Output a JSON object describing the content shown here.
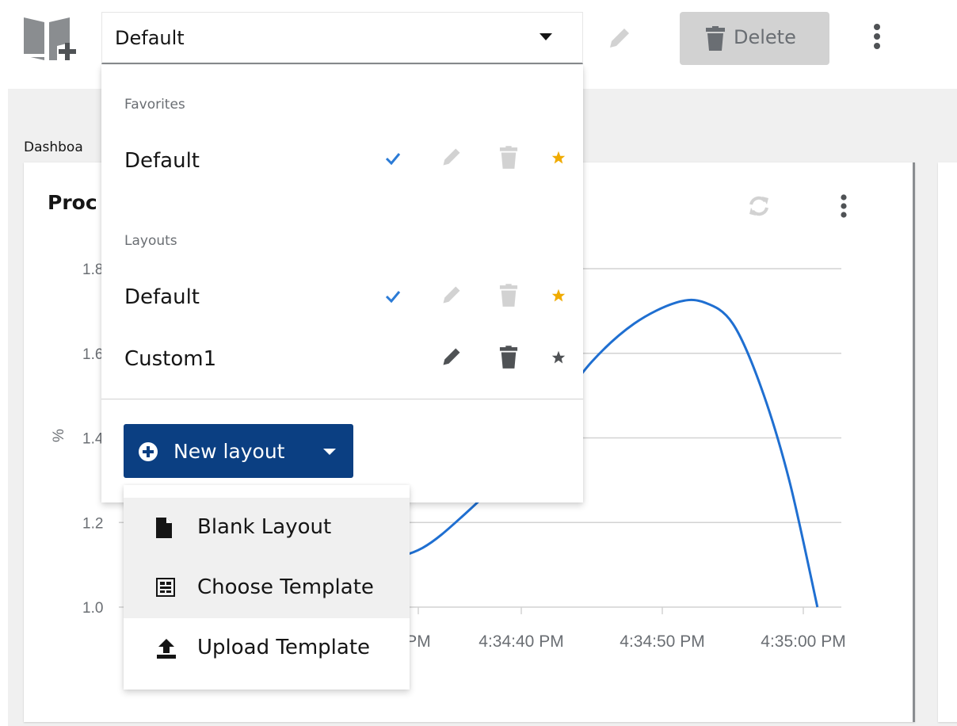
{
  "toolbar": {
    "selected_layout": "Default",
    "delete_label": "Delete"
  },
  "dashboard": {
    "title": "Dashboa",
    "card_title": "Proc"
  },
  "layout_menu": {
    "favorites_title": "Favorites",
    "favorites": [
      {
        "label": "Default",
        "selected": true,
        "favorite": true
      }
    ],
    "layouts_title": "Layouts",
    "layouts": [
      {
        "label": "Default",
        "selected": true,
        "favorite": true
      },
      {
        "label": "Custom1",
        "selected": false,
        "favorite": false
      }
    ],
    "new_layout_label": "New layout",
    "new_layout_options": [
      {
        "label": "Blank Layout",
        "icon": "file-icon"
      },
      {
        "label": "Choose Template",
        "icon": "template-icon"
      },
      {
        "label": "Upload Template",
        "icon": "upload-icon"
      }
    ]
  },
  "colors": {
    "primary_button": "#0b3f82",
    "check": "#2b7bd6",
    "star_favorite": "#f0ab00",
    "chart_line": "#1f6fd1"
  },
  "chart_data": {
    "type": "line",
    "ylabel": "%",
    "y_ticks": [
      "1.0",
      "1.2",
      "1.4",
      "1.6",
      "1.8"
    ],
    "x_ticks": [
      "PM",
      "4:34:40 PM",
      "4:34:50 PM",
      "4:35:00 PM"
    ],
    "ylim": [
      1.0,
      1.8
    ],
    "series": [
      {
        "x": [
          "4:34:28 PM",
          "4:34:30 PM",
          "4:34:33 PM",
          "4:34:36 PM",
          "4:34:39 PM",
          "4:34:42 PM",
          "4:34:45 PM",
          "4:34:48 PM",
          "4:34:51 PM",
          "4:34:53 PM",
          "4:34:55 PM",
          "4:34:57 PM",
          "4:34:59 PM",
          "4:35:01 PM"
        ],
        "y": [
          1.11,
          1.11,
          1.14,
          1.22,
          1.32,
          1.45,
          1.58,
          1.67,
          1.72,
          1.72,
          1.67,
          1.52,
          1.3,
          1.0
        ]
      }
    ],
    "grid": true
  }
}
